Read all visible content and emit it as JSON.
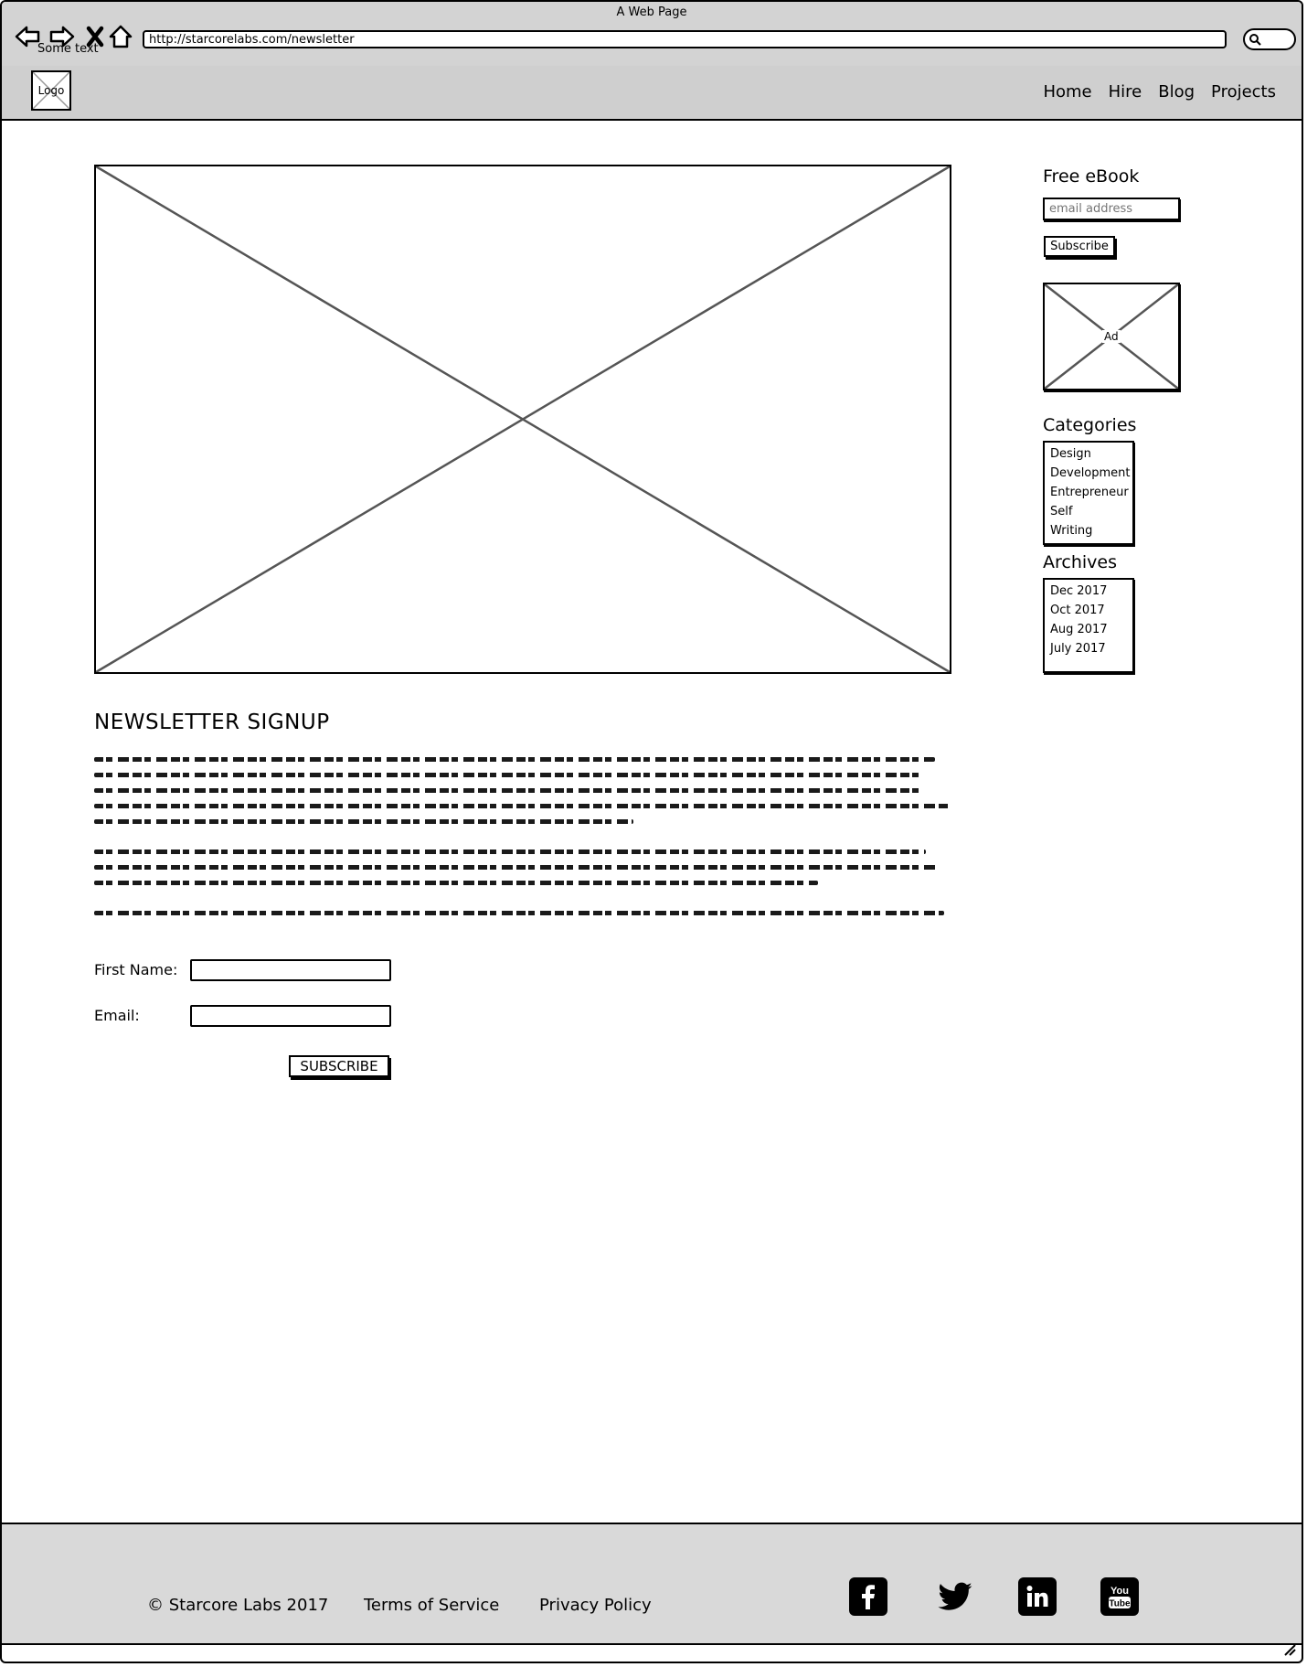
{
  "browser": {
    "window_title": "A Web Page",
    "chrome_text": "Some text",
    "url": "http://starcorelabs.com/newsletter"
  },
  "header": {
    "logo_text": "Logo",
    "nav": [
      "Home",
      "Hire",
      "Blog",
      "Projects"
    ]
  },
  "main": {
    "heading": "NEWSLETTER SIGNUP",
    "form": {
      "first_name_label": "First Name:",
      "first_name_value": "",
      "email_label": "Email:",
      "email_value": "",
      "submit_label": "SUBSCRIBE"
    }
  },
  "sidebar": {
    "ebook_heading": "Free eBook",
    "ebook_placeholder": "email address",
    "ebook_button": "Subscribe",
    "ad_label": "Ad",
    "categories_heading": "Categories",
    "categories": [
      "Design",
      "Development",
      "Entrepreneur",
      "Self",
      "Writing"
    ],
    "archives_heading": "Archives",
    "archives": [
      "Dec 2017",
      "Oct 2017",
      "Aug 2017",
      "July 2017"
    ]
  },
  "footer": {
    "copyright": "© Starcore Labs 2017",
    "terms": "Terms of Service",
    "privacy": "Privacy Policy",
    "social_icons": [
      "facebook-icon",
      "twitter-icon",
      "linkedin-icon",
      "youtube-icon"
    ]
  }
}
